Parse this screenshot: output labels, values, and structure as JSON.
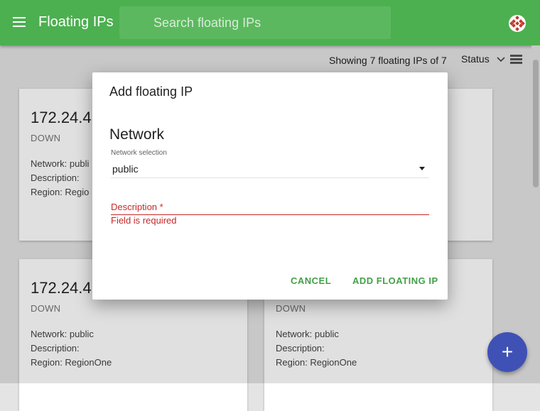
{
  "app": {
    "title": "Floating IPs",
    "search_placeholder": "Search floating IPs"
  },
  "toolbar": {
    "count_text": "Showing 7 floating IPs of 7",
    "sort_label": "Status",
    "sort_icon": "chevron-down-icon",
    "view_icon": "list-view-icon"
  },
  "cards": [
    {
      "ip": "172.24.4",
      "status": "DOWN",
      "network": "Network: publi",
      "description": "Description:",
      "region": "Region: Regio"
    },
    {
      "ip": "",
      "status": "",
      "network": "",
      "description": "",
      "region": ""
    },
    {
      "ip": "172.24.4",
      "status": "DOWN",
      "network": "Network: public",
      "description": "Description:",
      "region": "Region: RegionOne"
    },
    {
      "ip": "",
      "status": "DOWN",
      "network": "Network: public",
      "description": "Description:",
      "region": "Region: RegionOne"
    }
  ],
  "dialog": {
    "title": "Add floating IP",
    "section": "Network",
    "select_label": "Network selection",
    "select_value": "public",
    "description_label": "Description",
    "required_marker": "*",
    "error_text": "Field is required",
    "cancel_label": "CANCEL",
    "submit_label": "ADD FLOATING IP"
  },
  "fab": {
    "label": "+"
  },
  "colors": {
    "primary": "#4caf50",
    "accent": "#3f51b5",
    "error": "#c62828",
    "button_text": "#43a047"
  }
}
